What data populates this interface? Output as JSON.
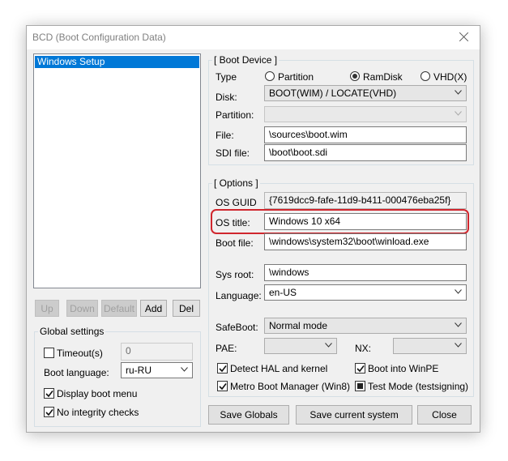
{
  "window": {
    "title": "BCD (Boot Configuration Data)"
  },
  "entries": {
    "items": [
      "Windows Setup"
    ]
  },
  "entry_buttons": {
    "up": "Up",
    "down": "Down",
    "default": "Default",
    "add": "Add",
    "del": "Del"
  },
  "global_settings": {
    "title": "Global settings",
    "timeout_label": "Timeout(s)",
    "timeout_checked": false,
    "timeout_value": "0",
    "boot_language_label": "Boot language:",
    "boot_language_value": "ru-RU",
    "display_boot_menu_label": "Display boot menu",
    "display_boot_menu_checked": true,
    "no_integrity_checks_label": "No integrity checks",
    "no_integrity_checks_checked": true
  },
  "boot_device": {
    "title": "[ Boot Device ]",
    "type_label": "Type",
    "type_options": [
      "Partition",
      "RamDisk",
      "VHD(X)"
    ],
    "type_selected": "RamDisk",
    "disk_label": "Disk:",
    "disk_value": "BOOT(WIM) / LOCATE(VHD)",
    "partition_label": "Partition:",
    "partition_value": "",
    "file_label": "File:",
    "file_value": "\\sources\\boot.wim",
    "sdi_label": "SDI file:",
    "sdi_value": "\\boot\\boot.sdi"
  },
  "options": {
    "title": "[ Options ]",
    "os_guid_label": "OS GUID",
    "os_guid_value": "{7619dcc9-fafe-11d9-b411-000476eba25f}",
    "os_title_label": "OS title:",
    "os_title_value": "Windows 10 x64",
    "boot_file_label": "Boot file:",
    "boot_file_value": "\\windows\\system32\\boot\\winload.exe",
    "sys_root_label": "Sys root:",
    "sys_root_value": "\\windows",
    "language_label": "Language:",
    "language_value": "en-US",
    "safeboot_label": "SafeBoot:",
    "safeboot_value": "Normal mode",
    "pae_label": "PAE:",
    "pae_value": "",
    "nx_label": "NX:",
    "nx_value": "",
    "detect_hal_label": "Detect HAL and kernel",
    "detect_hal_checked": true,
    "boot_winpe_label": "Boot into WinPE",
    "boot_winpe_checked": true,
    "metro_label": "Metro Boot Manager (Win8)",
    "metro_checked": true,
    "test_mode_label": "Test Mode (testsigning)",
    "test_mode_checked": "indeterminate"
  },
  "bottom_buttons": {
    "save_globals": "Save Globals",
    "save_current": "Save current system",
    "close": "Close"
  },
  "colors": {
    "selection": "#0078d7",
    "highlight": "#d0262d",
    "dialog_bg": "#f0f0f0"
  }
}
